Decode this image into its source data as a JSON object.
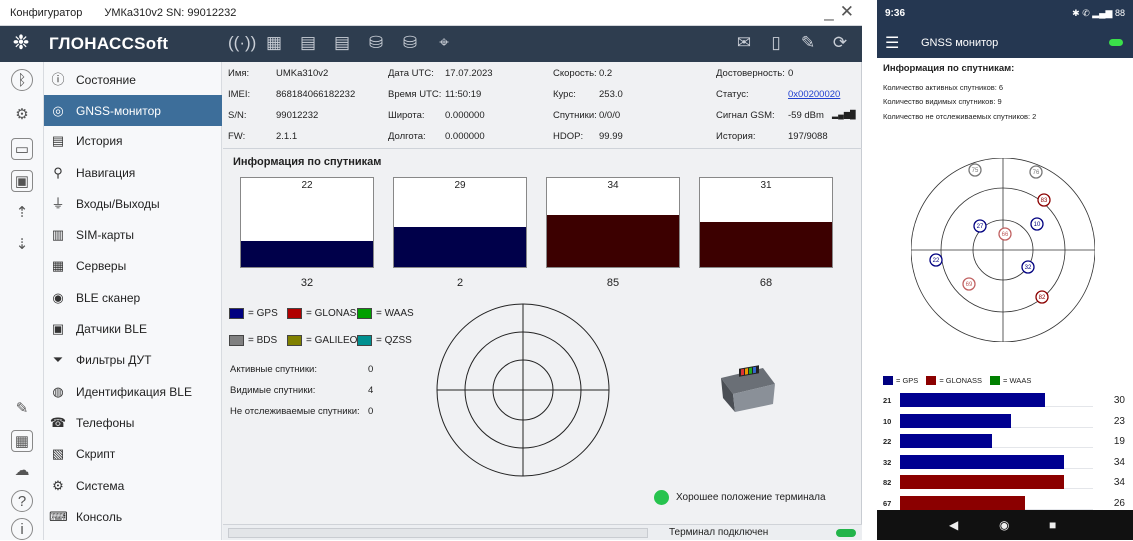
{
  "window": {
    "app": "Конфигуратор",
    "device": "УМКа310v2 SN: 99012232",
    "minimize": "_",
    "close": "✕"
  },
  "brand": {
    "name": "ГЛОНАССSoft",
    "logo_icon": "snowflake-icon"
  },
  "toolbar": {
    "left_icons": [
      "wifi-signal-icon",
      "terminal-gear-icon",
      "terminal-disabled-icon",
      "terminal-disabled-icon",
      "database-icon",
      "database-gear-icon",
      "map-pin-off-icon"
    ],
    "right_icons": [
      "envelope-icon",
      "document-icon",
      "signature-icon",
      "sync-icon"
    ]
  },
  "rail_icons": [
    "bluetooth-icon",
    "gear-icon",
    "folder-icon",
    "save-icon",
    "upload-icon",
    "download-icon",
    "edit-icon",
    "grid-icon",
    "cloud-icon",
    "help-icon",
    "info-icon"
  ],
  "nav": [
    {
      "label": "Состояние",
      "icon": "info-circle-icon"
    },
    {
      "label": "GNSS-монитор",
      "icon": "satellite-icon",
      "active": true
    },
    {
      "label": "История",
      "icon": "book-icon"
    },
    {
      "label": "Навигация",
      "icon": "satellite-dish-icon"
    },
    {
      "label": "Входы/Выходы",
      "icon": "plug-icon"
    },
    {
      "label": "SIM-карты",
      "icon": "sim-card-icon"
    },
    {
      "label": "Серверы",
      "icon": "server-icon"
    },
    {
      "label": "BLE сканер",
      "icon": "bluetooth-scan-icon"
    },
    {
      "label": "Датчики BLE",
      "icon": "sensor-icon"
    },
    {
      "label": "Фильтры ДУТ",
      "icon": "filter-icon"
    },
    {
      "label": "Идентификация BLE",
      "icon": "fingerprint-icon"
    },
    {
      "label": "Телефоны",
      "icon": "phone-icon"
    },
    {
      "label": "Скрипт",
      "icon": "script-icon"
    },
    {
      "label": "Система",
      "icon": "system-gear-icon"
    },
    {
      "label": "Консоль",
      "icon": "console-icon"
    }
  ],
  "info": {
    "c1": [
      [
        "Имя:",
        "UMKa310v2"
      ],
      [
        "IMEI:",
        "868184066182232"
      ],
      [
        "S/N:",
        "99012232"
      ],
      [
        "FW:",
        "2.1.1"
      ]
    ],
    "c2": [
      [
        "Дата UTC:",
        "17.07.2023"
      ],
      [
        "Время UTC:",
        "11:50:19"
      ],
      [
        "Широта:",
        "0.000000"
      ],
      [
        "Долгота:",
        "0.000000"
      ]
    ],
    "c3": [
      [
        "Скорость:",
        "0.2"
      ],
      [
        "Курс:",
        "253.0"
      ],
      [
        "Спутники:",
        "0/0/0"
      ],
      [
        "HDOP:",
        "99.99"
      ]
    ],
    "c4": [
      [
        "Достоверность:",
        "0"
      ],
      [
        "Статус:",
        "0x00200020"
      ],
      [
        "Сигнал GSM:",
        "-59 dBm"
      ],
      [
        "История:",
        "197/9088"
      ]
    ],
    "gsm_bars_icon": "signal-bars-icon"
  },
  "satellites": {
    "title": "Информация по спутникам",
    "boxes": [
      {
        "snr": "22",
        "id": "32",
        "level": 0.29,
        "color": "#00004a"
      },
      {
        "snr": "29",
        "id": "2",
        "level": 0.45,
        "color": "#00004a"
      },
      {
        "snr": "34",
        "id": "85",
        "level": 0.58,
        "color": "#3c0000"
      },
      {
        "snr": "31",
        "id": "68",
        "level": 0.51,
        "color": "#3c0000"
      }
    ]
  },
  "legend": [
    {
      "label": "= GPS",
      "color": "#000080"
    },
    {
      "label": "= GLONASS",
      "color": "#b00000"
    },
    {
      "label": "= WAAS",
      "color": "#00a000"
    },
    {
      "label": "= BDS",
      "color": "#808080"
    },
    {
      "label": "= GALILEO",
      "color": "#808000"
    },
    {
      "label": "= QZSS",
      "color": "#009090"
    }
  ],
  "stats": [
    [
      "Активные спутники:",
      "0"
    ],
    [
      "Видимые спутники:",
      "4"
    ],
    [
      "Не отслеживаемые спутники:",
      "0"
    ]
  ],
  "terminal_position": "Хорошее положение терминала",
  "status_bar": {
    "text": "Терминал подключен"
  },
  "phone": {
    "time": "9:36",
    "status_icons": "✱ ✆ ▂▄▆ 88",
    "title": "GNSS монитор",
    "heading": "Информация по спутникам:",
    "lines": [
      "Количество активных спутников:  6",
      "Количество видимых спутников:  9",
      "Количество не отслеживаемых спутников:  2"
    ],
    "legend": [
      {
        "label": "= GPS",
        "color": "#000080"
      },
      {
        "label": "= GLONASS",
        "color": "#8b0000"
      },
      {
        "label": "= WAAS",
        "color": "#008000"
      }
    ],
    "sats": [
      {
        "id": "75",
        "color": "#777"
      },
      {
        "id": "76",
        "color": "#777"
      },
      {
        "id": "83",
        "color": "#8b0000"
      },
      {
        "id": "27",
        "color": "#000080"
      },
      {
        "id": "66",
        "color": "#c06060"
      },
      {
        "id": "10",
        "color": "#000080"
      },
      {
        "id": "22",
        "color": "#000080"
      },
      {
        "id": "69",
        "color": "#c06060"
      },
      {
        "id": "32",
        "color": "#000080"
      },
      {
        "id": "82",
        "color": "#8b0000"
      }
    ],
    "bars": [
      {
        "id": "21",
        "snr": "30",
        "value": 30,
        "color": "#000090"
      },
      {
        "id": "10",
        "snr": "23",
        "value": 23,
        "color": "#000090"
      },
      {
        "id": "22",
        "snr": "19",
        "value": 19,
        "color": "#000090"
      },
      {
        "id": "32",
        "snr": "34",
        "value": 34,
        "color": "#000090"
      },
      {
        "id": "82",
        "snr": "34",
        "value": 34,
        "color": "#8b0000"
      },
      {
        "id": "67",
        "snr": "26",
        "value": 26,
        "color": "#8b0000"
      }
    ],
    "nav": [
      "◀",
      "◉",
      "■"
    ]
  }
}
